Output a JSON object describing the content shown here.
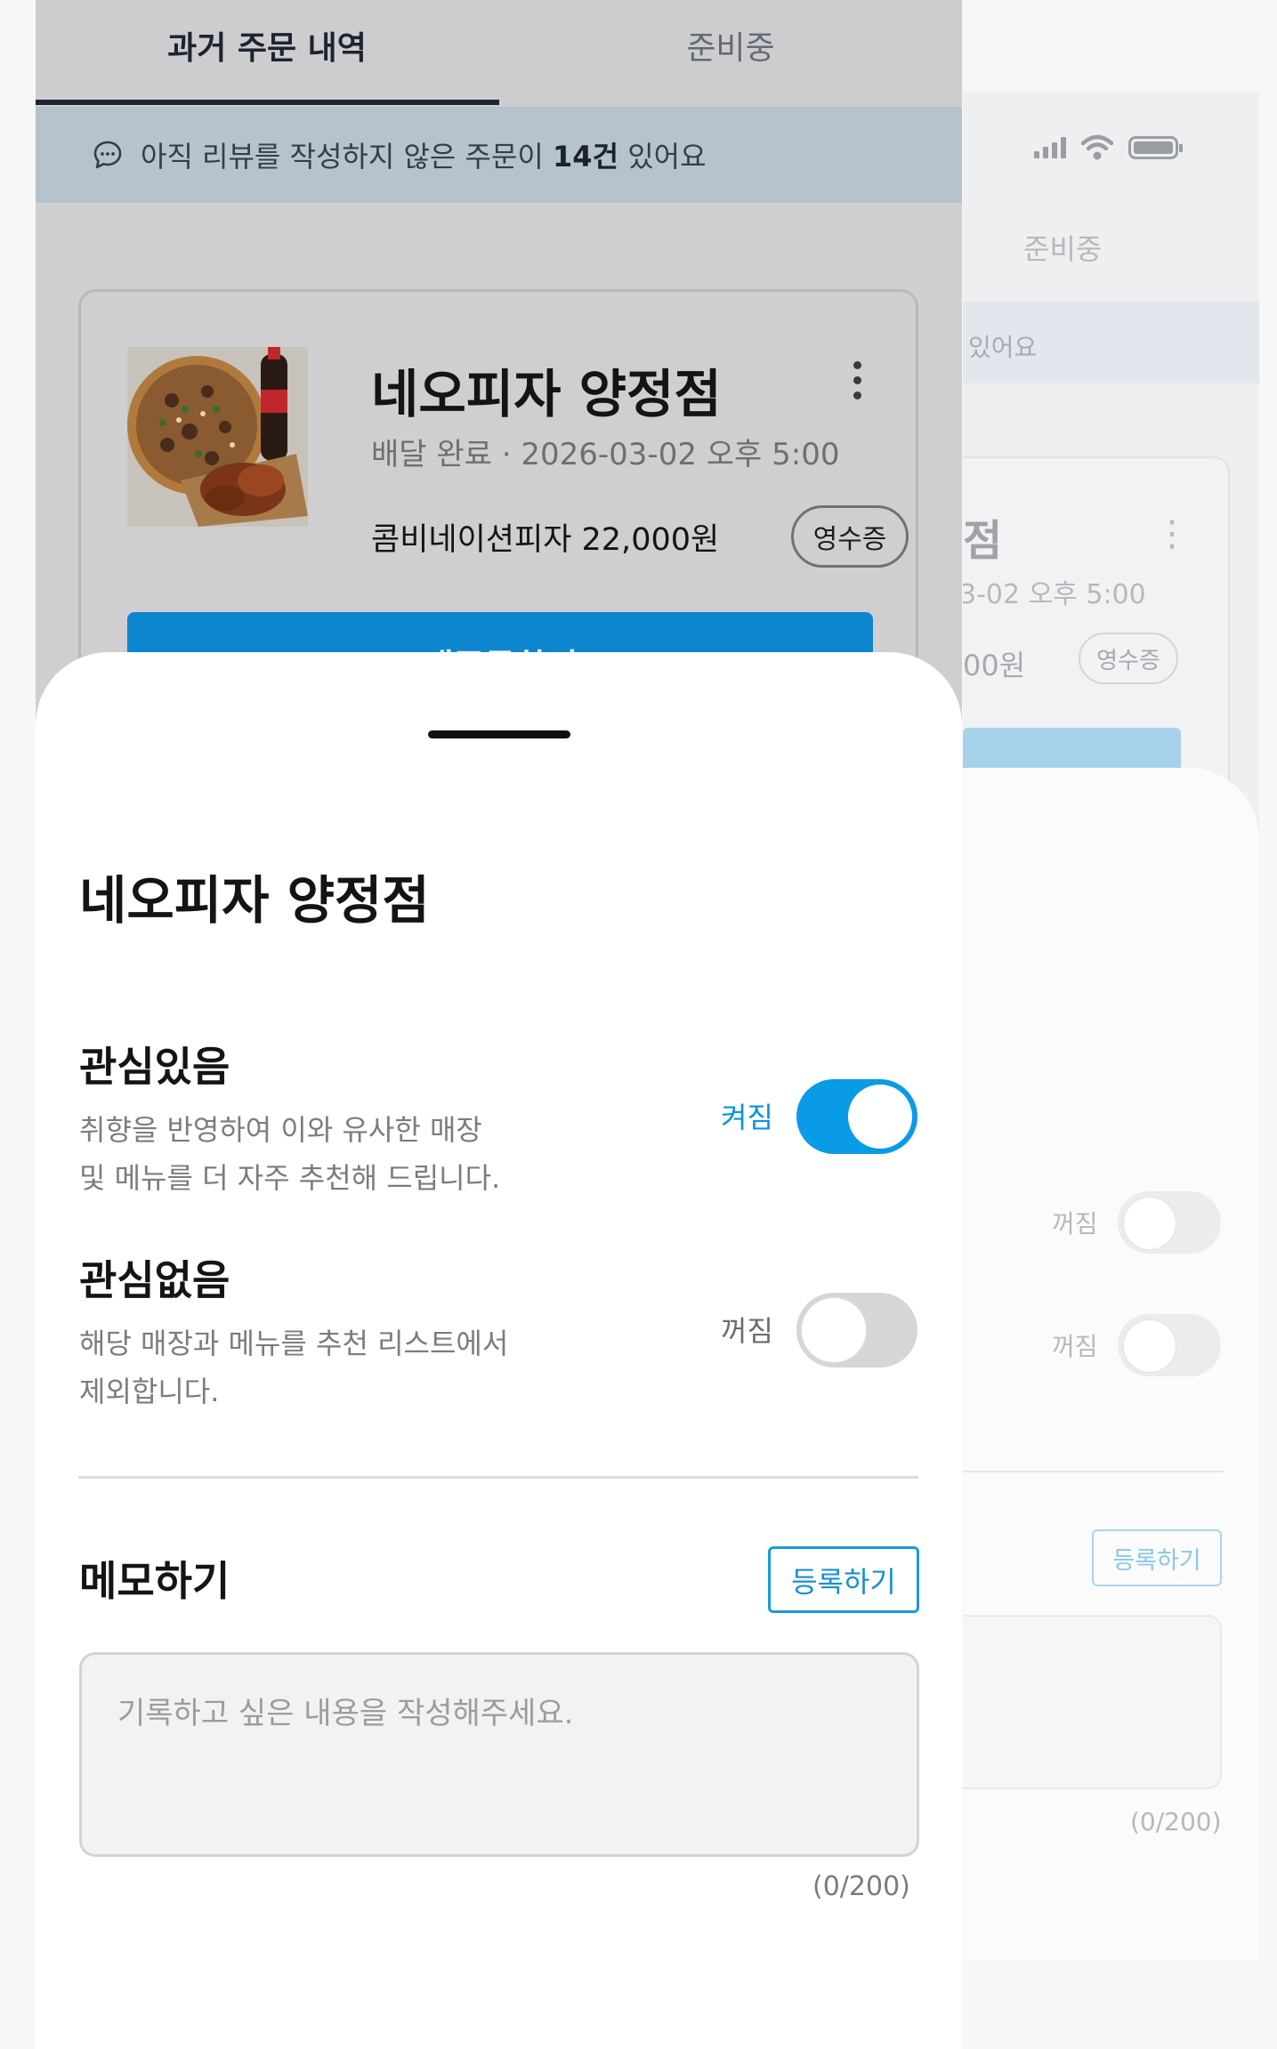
{
  "tabs": {
    "past_orders": "과거 주문 내역",
    "preparing": "준비중"
  },
  "banner": {
    "prefix": "아직 리뷰를 작성하지 않은 주문이",
    "count": "14건",
    "suffix": "있어요"
  },
  "order": {
    "store_name": "네오피자 양정점",
    "status": "배달 완료",
    "datetime": "2026-03-02 오후 5:00",
    "item_summary": "콤비네이션피자 22,000원",
    "receipt_label": "영수증",
    "reorder_label": "재주문하기"
  },
  "sheet": {
    "title": "네오피자 양정점",
    "interested": {
      "title": "관심있음",
      "desc_line1": "취향을 반영하여 이와 유사한 매장",
      "desc_line2": "및 메뉴를 더 자주 추천해 드립니다.",
      "state_label": "켜짐",
      "on": true
    },
    "not_interested": {
      "title": "관심없음",
      "desc_line1": "해당 매장과 메뉴를 추천 리스트에서",
      "desc_line2": "제외합니다.",
      "state_label": "꺼짐",
      "on": false
    },
    "memo": {
      "title": "메모하기",
      "register_label": "등록하기",
      "placeholder": "기록하고 싶은 내용을 작성해주세요.",
      "count": "(0/200)"
    }
  },
  "background_screen": {
    "tab_label": "준비중",
    "banner_fragment": "있어요",
    "store_fragment": "점",
    "date_fragment": "3-02 오후 5:00",
    "price_fragment": "00원",
    "receipt_label": "영수증",
    "toggle1_label": "꺼짐",
    "toggle2_label": "꺼짐",
    "register_label": "등록하기",
    "count": "(0/200)"
  },
  "colors": {
    "accent": "#0a9be6",
    "reorder_button": "#0d86cf",
    "banner_bg": "#b4c3cc",
    "dim_bg": "#cfcfd1"
  },
  "icons": [
    "chat-bubble-icon",
    "more-vertical-icon",
    "signal-icon",
    "wifi-icon",
    "battery-icon"
  ]
}
